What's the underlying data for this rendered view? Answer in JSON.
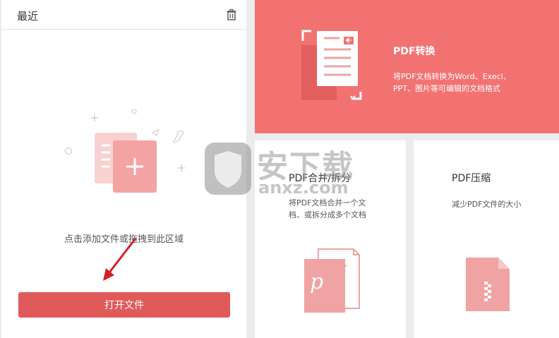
{
  "recent": {
    "title": "最近",
    "drop_hint": "点击添加文件或拖拽到此区域",
    "open_button": "打开文件"
  },
  "cards": {
    "convert": {
      "title": "PDF转换",
      "desc_line1": "将PDF文档转换为Word、Execl、",
      "desc_line2": "PPT、图片等可编辑的文档格式"
    },
    "merge": {
      "title": "PDF合并/拆分",
      "desc_line1": "将PDF文档合并一个文",
      "desc_line2": "档、或拆分成多个文档"
    },
    "compress": {
      "title": "PDF压缩",
      "desc": "减少PDF文件的大小"
    }
  },
  "watermark": {
    "text": "安下载",
    "domain": "anxz.com"
  },
  "colors": {
    "accent": "#e05a5a",
    "card_red": "#f27272",
    "icon_pink": "#f0a3a3"
  }
}
